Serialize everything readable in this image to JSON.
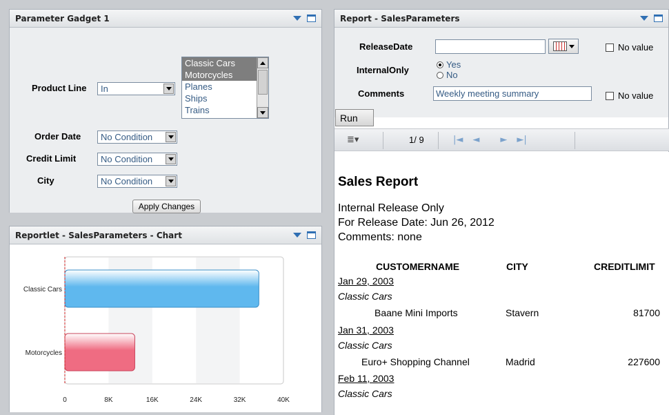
{
  "parameter_gadget": {
    "title": "Parameter Gadget 1",
    "product_line_label": "Product Line",
    "product_line_operator": "In",
    "product_line_options": [
      "Classic Cars",
      "Motorcycles",
      "Planes",
      "Ships",
      "Trains"
    ],
    "product_line_selected": [
      "Classic Cars",
      "Motorcycles"
    ],
    "order_date_label": "Order Date",
    "order_date_value": "No Condition",
    "credit_limit_label": "Credit Limit",
    "credit_limit_value": "No Condition",
    "city_label": "City",
    "city_value": "No Condition",
    "apply_label": "Apply Changes"
  },
  "chart_panel": {
    "title": "Reportlet - SalesParameters - Chart"
  },
  "chart_data": {
    "type": "bar",
    "orientation": "horizontal",
    "categories": [
      "Classic Cars",
      "Motorcycles"
    ],
    "values": [
      35500,
      12800
    ],
    "x_ticks": [
      "0",
      "8K",
      "16K",
      "24K",
      "32K",
      "40K"
    ],
    "xlim": [
      0,
      40000
    ],
    "colors": [
      "#5fb8ee",
      "#ef6c82"
    ],
    "grid": true,
    "legend": "none"
  },
  "report_panel": {
    "title": "Report - SalesParameters",
    "release_date_label": "ReleaseDate",
    "release_date_value": "",
    "no_value_label": "No value",
    "internal_only_label": "InternalOnly",
    "radio_yes": "Yes",
    "radio_no": "No",
    "comments_label": "Comments",
    "comments_value": "Weekly meeting summary",
    "no_value_label_2": "No value",
    "run_label": "Run",
    "page_indicator": "1/ 9"
  },
  "report": {
    "title": "Sales Report",
    "line1": "Internal Release Only",
    "line2": "For Release Date: Jun 26, 2012",
    "line3": "Comments: none",
    "columns": [
      "CUSTOMERNAME",
      "CITY",
      "CREDITLIMIT"
    ],
    "groups": [
      {
        "date": "Jan 29, 2003",
        "product": "Classic Cars",
        "customer": "Baane Mini Imports",
        "city": "Stavern",
        "credit": "81700"
      },
      {
        "date": "Jan 31, 2003",
        "product": "Classic Cars",
        "customer": "Euro+ Shopping Channel",
        "city": "Madrid",
        "credit": "227600"
      },
      {
        "date": "Feb 11, 2003",
        "product": "Classic Cars"
      }
    ]
  }
}
